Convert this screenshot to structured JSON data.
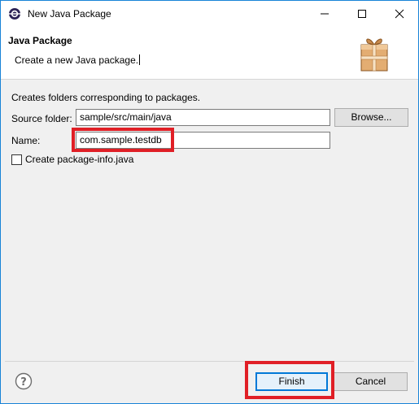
{
  "window": {
    "title": "New Java Package"
  },
  "header": {
    "title": "Java Package",
    "description": "Create a new Java package."
  },
  "form": {
    "description": "Creates folders corresponding to packages.",
    "source_folder": {
      "label": "Source folder:",
      "value": "sample/src/main/java"
    },
    "browse_label": "Browse...",
    "name": {
      "label": "Name:",
      "value": "com.sample.testdb"
    },
    "package_info": {
      "label": "Create package-info.java",
      "checked": false
    }
  },
  "footer": {
    "finish_label": "Finish",
    "cancel_label": "Cancel"
  },
  "icons": {
    "app": "eclipse-icon",
    "wizard": "package-gift-icon",
    "help": "help-icon"
  },
  "colors": {
    "highlight": "#e01f26",
    "window_border": "#1883d7",
    "default_button_border": "#0078d7"
  }
}
